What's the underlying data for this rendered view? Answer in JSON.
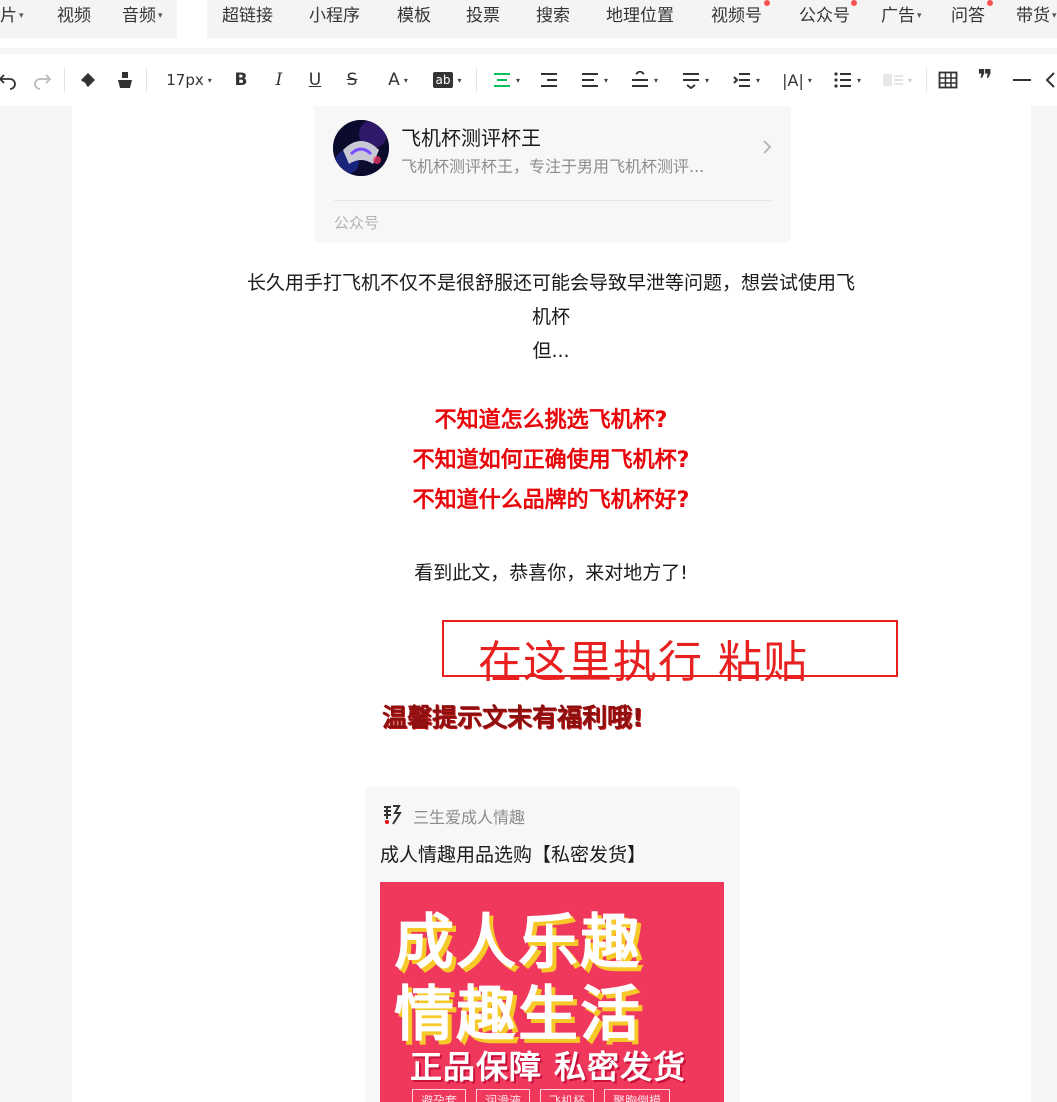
{
  "insert_tabs": {
    "left": [
      {
        "label": "片",
        "caret": true
      },
      {
        "label": "视频",
        "caret": false
      },
      {
        "label": "音频",
        "caret": true
      }
    ],
    "right": [
      {
        "label": "超链接",
        "caret": false,
        "dot": false
      },
      {
        "label": "小程序",
        "caret": false,
        "dot": false
      },
      {
        "label": "模板",
        "caret": false,
        "dot": false
      },
      {
        "label": "投票",
        "caret": false,
        "dot": false
      },
      {
        "label": "搜索",
        "caret": false,
        "dot": false
      },
      {
        "label": "地理位置",
        "caret": false,
        "dot": false
      },
      {
        "label": "视频号",
        "caret": false,
        "dot": true
      },
      {
        "label": "公众号",
        "caret": false,
        "dot": true
      },
      {
        "label": "广告",
        "caret": true,
        "dot": false
      },
      {
        "label": "问答",
        "caret": false,
        "dot": true
      },
      {
        "label": "带货",
        "caret": true,
        "dot": false
      }
    ]
  },
  "toolbar": {
    "font_size": "17px",
    "icons": [
      "undo-icon",
      "redo-icon",
      "eraser-icon",
      "format-brush-icon",
      "bold-icon",
      "italic-icon",
      "underline-icon",
      "strikethrough-icon",
      "font-color-icon",
      "background-color-icon",
      "align-center-icon",
      "indent-icon",
      "align-justify-icon",
      "line-spacing-icon",
      "paragraph-spacing-icon",
      "list-indent-icon",
      "letter-spacing-icon",
      "list-icon",
      "layout-icon",
      "table-icon",
      "quote-icon",
      "divider-icon",
      "more-icon"
    ],
    "accent_color": "#07c160"
  },
  "account_card": {
    "name": "飞机杯测评杯王",
    "description": "飞机杯测评杯王，专注于男用飞机杯测评...",
    "type_label": "公众号"
  },
  "article": {
    "intro_line1": "长久用手打飞机不仅不是很舒服还可能会导致早泄等问题，想尝试使用飞",
    "intro_line2": "机杯",
    "intro_line3": "但...",
    "questions": [
      "不知道怎么挑选飞机杯?",
      "不知道如何正确使用飞机杯?",
      "不知道什么品牌的飞机杯好?"
    ],
    "congrats": "看到此文，恭喜你，来对地方了!",
    "paste_hint": "在这里执行 粘贴",
    "tip": "温馨提示文末有福利哦!",
    "highlight_color": "#e8060b"
  },
  "mini_program": {
    "shop_name": "三生爱成人情趣",
    "title": "成人情趣用品选购【私密发货】",
    "banner": {
      "line1": "成人乐趣",
      "line2": "情趣生活",
      "line3": "正品保障 私密发货",
      "tags": [
        "避孕套",
        "润滑液",
        "飞机杯",
        "聚胸倒模"
      ],
      "bg_color": "#f0385c"
    }
  }
}
